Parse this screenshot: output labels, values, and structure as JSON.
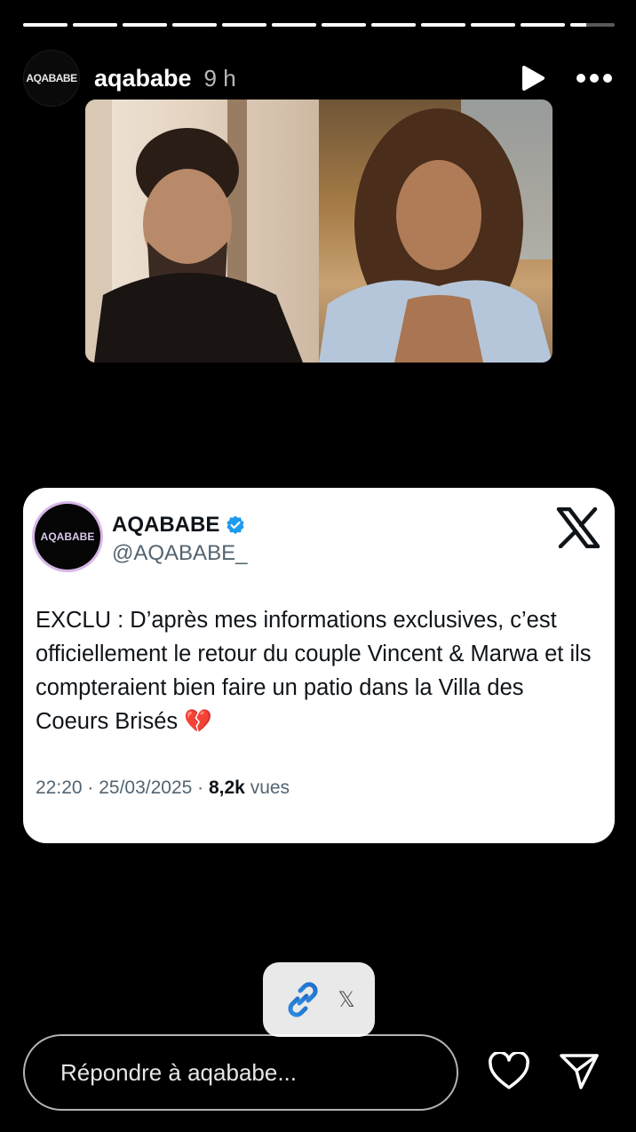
{
  "progress": {
    "segments_total": 12,
    "segments_complete": 11,
    "current_fraction": 0.35
  },
  "header": {
    "avatar_text": "AQABABE",
    "username": "aqababe",
    "time": "9 h"
  },
  "tweet": {
    "avatar_text": "AQABABE",
    "name": "AQABABE",
    "handle": "@AQABABE_",
    "text": "EXCLU : D’après mes informations exclusives, c’est officiellement le retour du couple Vincent & Marwa et ils compteraient bien faire un patio dans la Villa des Coeurs Brisés 💔",
    "time": "22:20 · 25/03/2025 · ",
    "views_count": "8,2k",
    "views_label": " vues",
    "verified_color": "#1d9bf0"
  },
  "sticker": {
    "label": "𝕏"
  },
  "reply": {
    "placeholder": "Répondre à aqababe..."
  },
  "icons": {
    "play": "play-icon",
    "more": "more-icon",
    "link": "link-icon",
    "heart": "heart-icon",
    "send": "send-icon",
    "x_logo": "x-logo-icon"
  }
}
